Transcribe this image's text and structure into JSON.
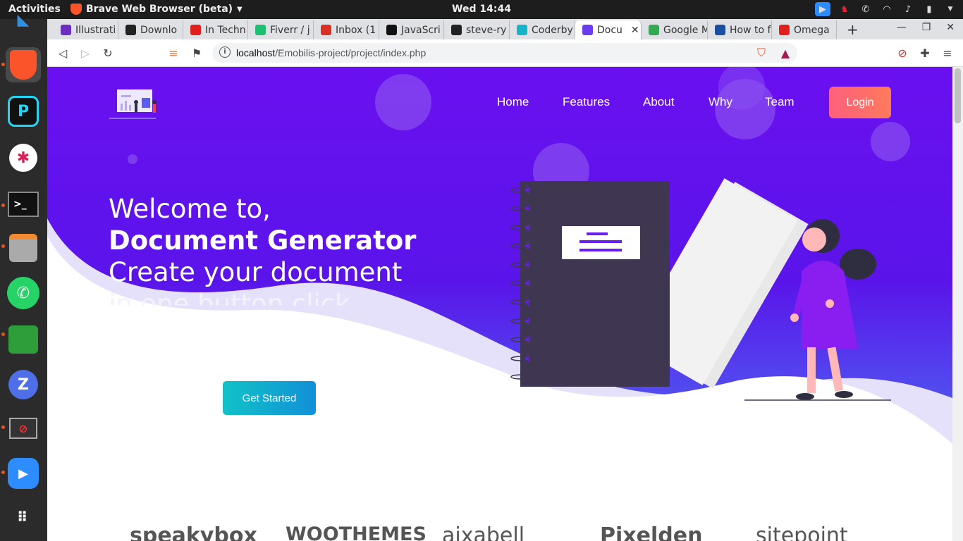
{
  "system": {
    "activities": "Activities",
    "app_name": "Brave Web Browser (beta)",
    "clock": "Wed 14:44"
  },
  "tabs": [
    {
      "label": "Illustrati",
      "color": "#6b2fbf"
    },
    {
      "label": "Downlo",
      "color": "#222222"
    },
    {
      "label": "In Techn",
      "color": "#e0201c"
    },
    {
      "label": "Fiverr / j",
      "color": "#1dbf73"
    },
    {
      "label": "Inbox (1",
      "color": "#d93025"
    },
    {
      "label": "JavaScri",
      "color": "#111111"
    },
    {
      "label": "steve-ry",
      "color": "#222222"
    },
    {
      "label": "Coderby",
      "color": "#19b3c8"
    },
    {
      "label": "Docu",
      "color": "#6a3df0"
    },
    {
      "label": "Google M",
      "color": "#34a853"
    },
    {
      "label": "How to f",
      "color": "#1a4fa0"
    },
    {
      "label": "Omega",
      "color": "#e0201c"
    }
  ],
  "toolbar": {
    "url_host": "localhost",
    "url_path": "/Emobilis-project/project/index.php"
  },
  "hero": {
    "nav": [
      "Home",
      "Features",
      "About",
      "Why",
      "Team"
    ],
    "login": "Login",
    "line1": "Welcome to,",
    "line2": "Document Generator",
    "line3": "Create your document",
    "line4": "in one button click",
    "cta": "Get Started",
    "partner_logos": [
      "speakybox",
      "WOOTHEMES",
      "aixabell",
      "Pixelden",
      "sitepoint"
    ]
  }
}
